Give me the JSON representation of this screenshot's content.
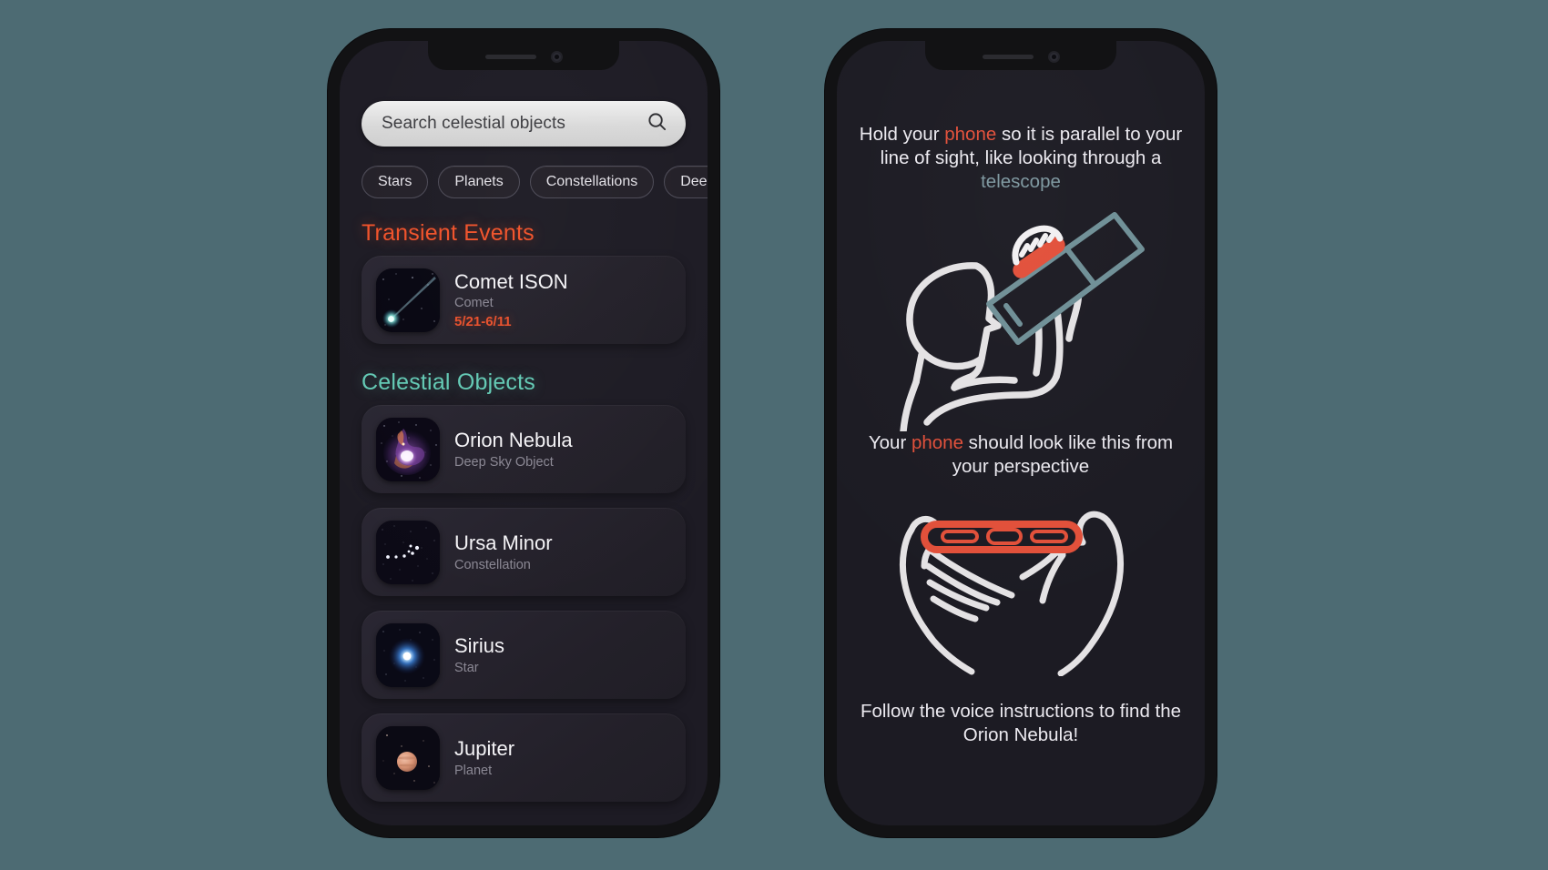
{
  "background_color": "#4d6b73",
  "left_phone": {
    "name": "celestial-browser-screen",
    "search": {
      "placeholder": "Search celestial objects",
      "value": "",
      "icon": "search-icon"
    },
    "filter_chips": [
      {
        "label": "Stars"
      },
      {
        "label": "Planets"
      },
      {
        "label": "Constellations"
      },
      {
        "label": "Deep Sky O"
      }
    ],
    "sections": [
      {
        "title": "Transient Events",
        "color": "#f0522a",
        "items": [
          {
            "title": "Comet ISON",
            "subtitle": "Comet",
            "date": "5/21-6/11",
            "thumb": "comet-thumbnail"
          }
        ]
      },
      {
        "title": "Celestial Objects",
        "color": "#63c9b4",
        "items": [
          {
            "title": "Orion Nebula",
            "subtitle": "Deep Sky Object",
            "thumb": "nebula-thumbnail"
          },
          {
            "title": "Ursa Minor",
            "subtitle": "Constellation",
            "thumb": "constellation-thumbnail"
          },
          {
            "title": "Sirius",
            "subtitle": "Star",
            "thumb": "star-thumbnail"
          },
          {
            "title": "Jupiter",
            "subtitle": "Planet",
            "thumb": "planet-thumbnail"
          }
        ]
      }
    ]
  },
  "right_phone": {
    "name": "telescope-instructions-screen",
    "instruction_top": {
      "part1": "Hold your ",
      "highlight1": "phone",
      "part2": " so it is parallel to your line of sight, like looking through a ",
      "highlight2": "telescope"
    },
    "instruction_mid": {
      "part1": "Your ",
      "highlight1": "phone",
      "part2": " should look like this from your perspective"
    },
    "instruction_bottom": "Follow the voice instructions to find the Orion Nebula!",
    "illustrations": [
      {
        "name": "person-with-telescope-illustration"
      },
      {
        "name": "hands-holding-phone-illustration"
      }
    ],
    "colors": {
      "highlight_phone": "#e2503a",
      "highlight_telescope": "#7e98a0",
      "line_art": "#e4e2e4",
      "telescope_body": "#6a8a91"
    }
  }
}
